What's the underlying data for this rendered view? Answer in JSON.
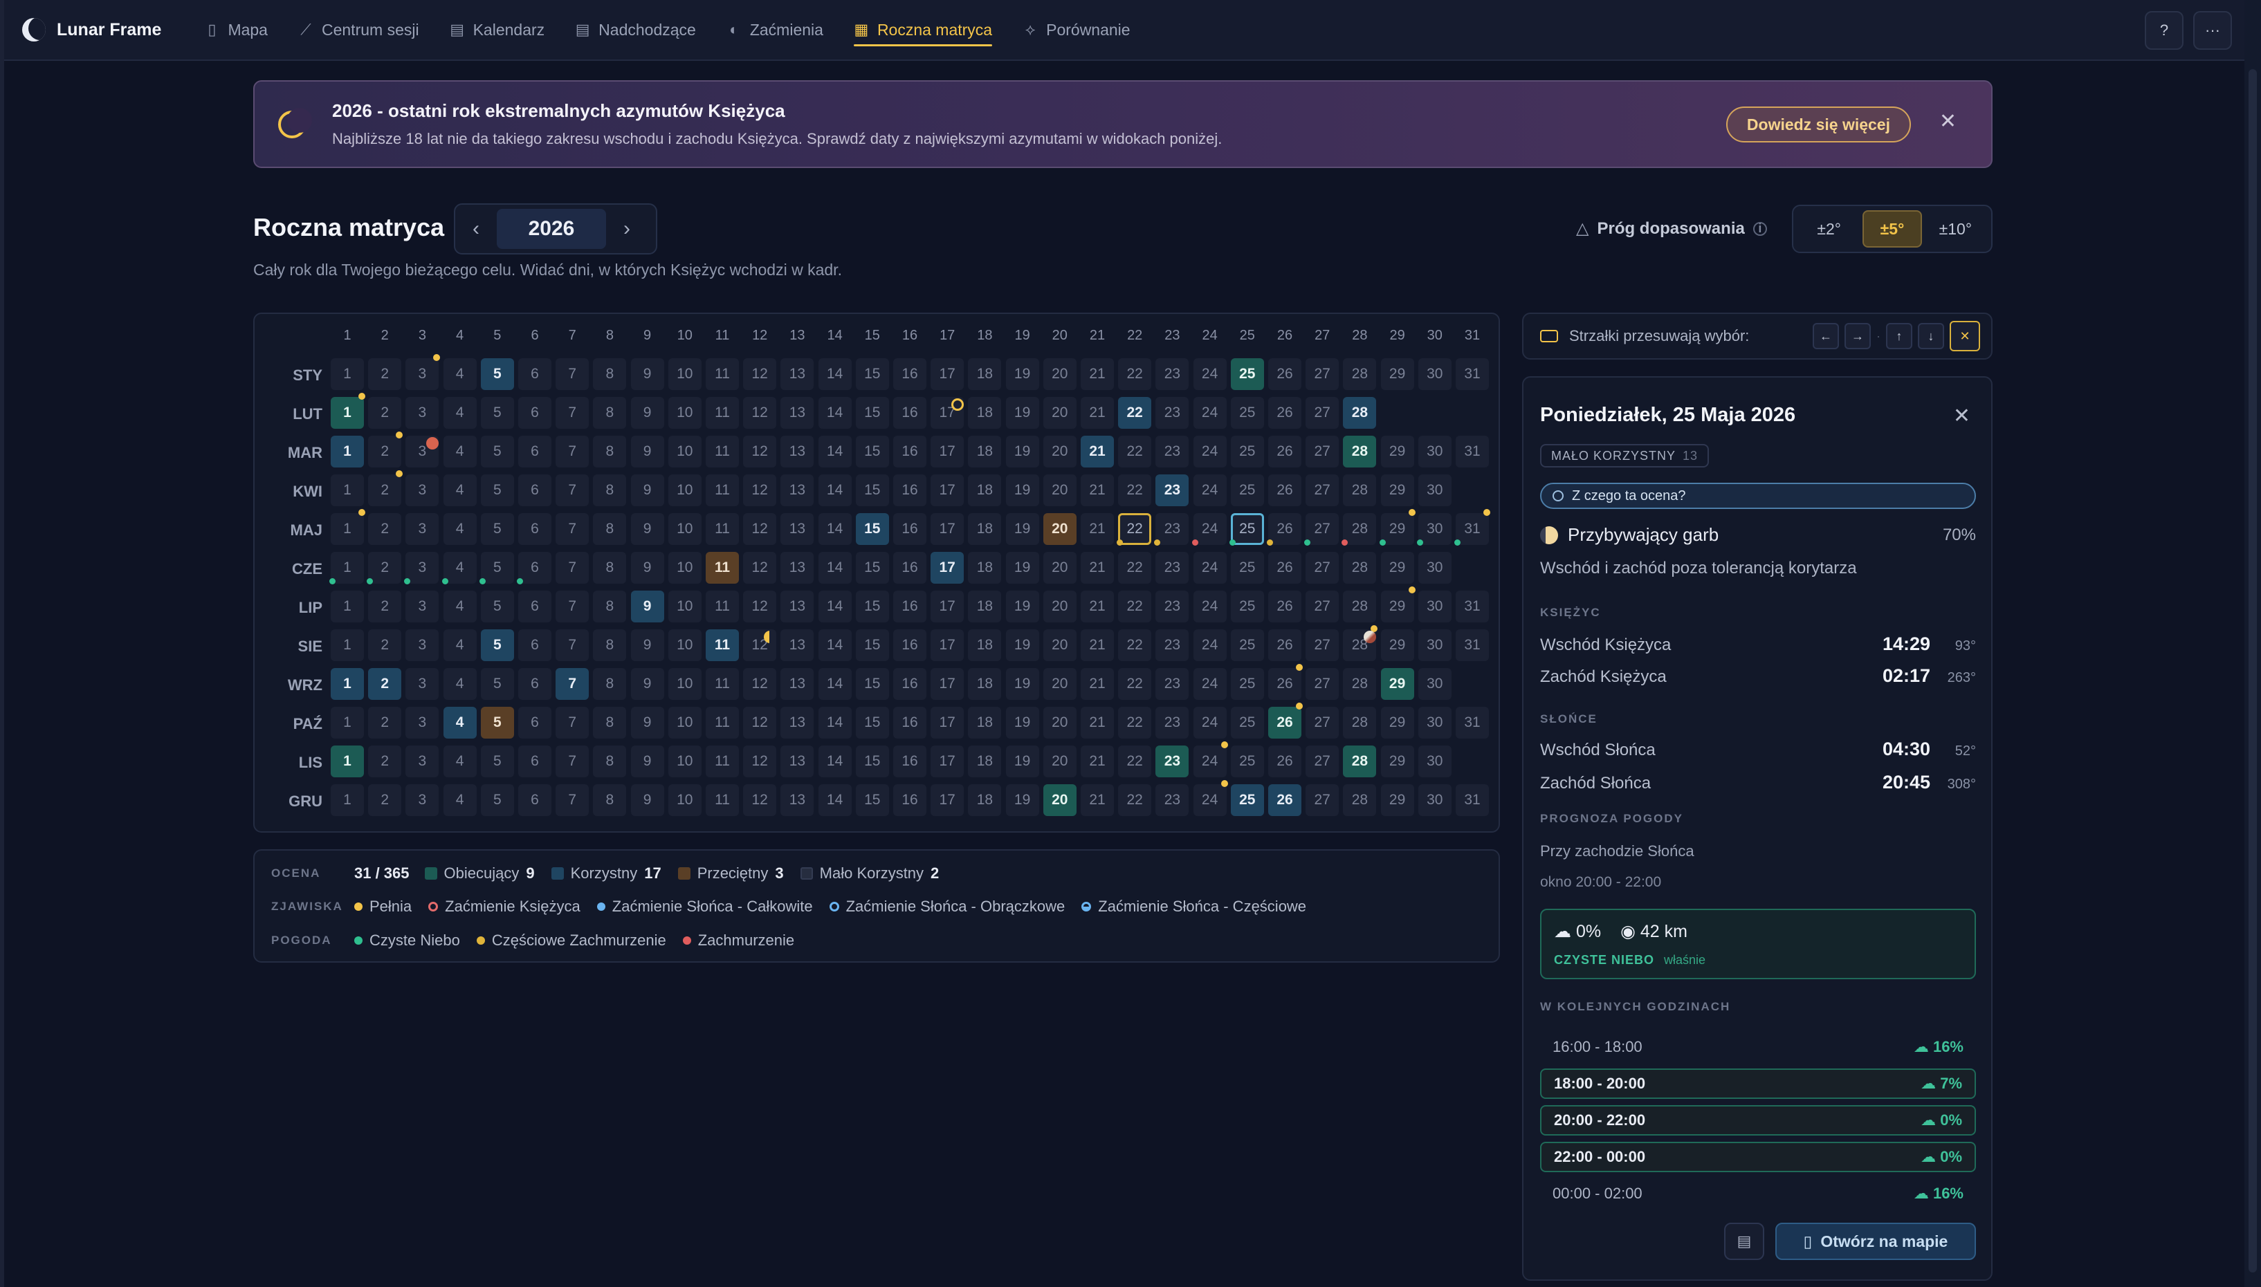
{
  "app": {
    "name": "Lunar Frame",
    "nav": [
      {
        "label": "Mapa",
        "icon": "map-icon",
        "glyph": "▯"
      },
      {
        "label": "Centrum sesji",
        "icon": "telescope-icon",
        "glyph": "⟋"
      },
      {
        "label": "Kalendarz",
        "icon": "calendar-icon",
        "glyph": "▤"
      },
      {
        "label": "Nadchodzące",
        "icon": "calendar-clock-icon",
        "glyph": "▤"
      },
      {
        "label": "Zaćmienia",
        "icon": "eclipse-icon",
        "glyph": "◐"
      },
      {
        "label": "Roczna matryca",
        "icon": "grid-icon",
        "glyph": "▦",
        "active": true
      },
      {
        "label": "Porównanie",
        "icon": "compare-icon",
        "glyph": "⟡"
      }
    ],
    "help_glyph": "?",
    "more_glyph": "···"
  },
  "banner": {
    "title": "2026 - ostatni rok ekstremalnych azymutów Księżyca",
    "subtitle": "Najbliższe 18 lat nie da takiego zakresu wschodu i zachodu Księżyca. Sprawdź daty z największymi azymutami w widokach poniżej.",
    "button": "Dowiedz się więcej",
    "close": "✕"
  },
  "header": {
    "title": "Roczna matryca",
    "year": "2026",
    "prev": "‹",
    "next": "›",
    "subtitle": "Cały rok dla Twojego bieżącego celu. Widać dni, w których Księżyc wchodzi w kadr.",
    "threshold_label": "Próg dopasowania",
    "threshold_options": [
      "±2°",
      "±5°",
      "±10°"
    ],
    "threshold_active": "±5°"
  },
  "matrix": {
    "days_header": [
      "1",
      "2",
      "3",
      "4",
      "5",
      "6",
      "7",
      "8",
      "9",
      "10",
      "11",
      "12",
      "13",
      "14",
      "15",
      "16",
      "17",
      "18",
      "19",
      "20",
      "21",
      "22",
      "23",
      "24",
      "25",
      "26",
      "27",
      "28",
      "29",
      "30",
      "31"
    ],
    "months": [
      {
        "label": "STY",
        "days": 31,
        "prom": [
          25
        ],
        "kor": [
          5
        ],
        "prz": []
      },
      {
        "label": "LUT",
        "days": 28,
        "prom": [
          1
        ],
        "kor": [
          22,
          28
        ],
        "prz": []
      },
      {
        "label": "MAR",
        "days": 31,
        "prom": [
          28
        ],
        "kor": [
          1,
          21
        ],
        "prz": []
      },
      {
        "label": "KWI",
        "days": 30,
        "prom": [],
        "kor": [
          23
        ],
        "prz": []
      },
      {
        "label": "MAJ",
        "days": 31,
        "prom": [],
        "kor": [
          15
        ],
        "prz": [
          20
        ],
        "sel": [
          25
        ],
        "yel": [
          22
        ]
      },
      {
        "label": "CZE",
        "days": 30,
        "prom": [],
        "kor": [
          17
        ],
        "prz": [
          11
        ]
      },
      {
        "label": "LIP",
        "days": 31,
        "prom": [],
        "kor": [
          9
        ],
        "prz": []
      },
      {
        "label": "SIE",
        "days": 31,
        "prom": [],
        "kor": [
          5,
          11
        ],
        "prz": []
      },
      {
        "label": "WRZ",
        "days": 30,
        "prom": [
          29
        ],
        "kor": [
          1,
          2,
          7
        ],
        "prz": []
      },
      {
        "label": "PAŹ",
        "days": 31,
        "prom": [
          26
        ],
        "kor": [
          4
        ],
        "prz": [
          5
        ]
      },
      {
        "label": "LIS",
        "days": 30,
        "prom": [
          1,
          23,
          28
        ],
        "kor": [],
        "prz": []
      },
      {
        "label": "GRU",
        "days": 31,
        "prom": [
          20
        ],
        "kor": [
          25,
          26
        ],
        "prz": []
      }
    ],
    "full_moon_dots": [
      [
        0,
        3
      ],
      [
        1,
        1
      ],
      [
        2,
        2
      ],
      [
        3,
        2
      ],
      [
        4,
        1
      ],
      [
        4,
        31
      ],
      [
        6,
        29
      ],
      [
        7,
        28
      ],
      [
        8,
        26
      ],
      [
        9,
        26
      ],
      [
        10,
        24
      ],
      [
        11,
        24
      ],
      [
        4,
        29
      ]
    ],
    "eclipse_markers": [
      [
        1,
        17,
        "ring"
      ],
      [
        2,
        3,
        "lunar"
      ],
      [
        7,
        12,
        "crescent"
      ],
      [
        7,
        28,
        "moon"
      ]
    ],
    "weather_dots": [
      [
        4,
        22,
        "yellow"
      ],
      [
        4,
        23,
        "yellow"
      ],
      [
        4,
        24,
        "red"
      ],
      [
        4,
        25,
        "green"
      ],
      [
        4,
        26,
        "yellow"
      ],
      [
        4,
        27,
        "green"
      ],
      [
        4,
        28,
        "red"
      ],
      [
        4,
        29,
        "green"
      ],
      [
        4,
        30,
        "green"
      ],
      [
        4,
        31,
        "green"
      ],
      [
        5,
        1,
        "green"
      ],
      [
        5,
        2,
        "green"
      ],
      [
        5,
        3,
        "green"
      ],
      [
        5,
        4,
        "green"
      ],
      [
        5,
        5,
        "green"
      ],
      [
        5,
        6,
        "green"
      ]
    ]
  },
  "legend": {
    "rating_key": "OCENA",
    "rating_total": "31 / 365",
    "ratings": [
      {
        "label": "Obiecujący",
        "count": "9",
        "color": "#1c5b54"
      },
      {
        "label": "Korzystny",
        "count": "17",
        "color": "#1f4561"
      },
      {
        "label": "Przeciętny",
        "count": "3",
        "color": "#5a3f26"
      },
      {
        "label": "Mało Korzystny",
        "count": "2",
        "color": "#262d3f"
      }
    ],
    "phenomena_key": "ZJAWISKA",
    "phenomena": [
      {
        "label": "Pełnia",
        "color": "#f3c449",
        "kind": "dot"
      },
      {
        "label": "Zaćmienie Księżyca",
        "color": "#e26b6b",
        "kind": "ring"
      },
      {
        "label": "Zaćmienie Słońca - Całkowite",
        "color": "#6ab4f0",
        "kind": "dot"
      },
      {
        "label": "Zaćmienie Słońca - Obrączkowe",
        "color": "#6ab4f0",
        "kind": "ring"
      },
      {
        "label": "Zaćmienie Słońca - Częściowe",
        "color": "#6ab4f0",
        "kind": "half"
      }
    ],
    "weather_key": "POGODA",
    "weather": [
      {
        "label": "Czyste Niebo",
        "color": "#2fbf8f"
      },
      {
        "label": "Częściowe Zachmurzenie",
        "color": "#e0b43a"
      },
      {
        "label": "Zachmurzenie",
        "color": "#e05d5d"
      }
    ]
  },
  "arrows_bar": {
    "text": "Strzałki przesuwają wybór:",
    "keys": [
      "←",
      "→",
      "↑",
      "↓"
    ],
    "sep": "·",
    "close": "✕"
  },
  "detail": {
    "title": "Poniedziałek, 25 Maja 2026",
    "close": "✕",
    "badge": "MAŁO KORZYSTNY",
    "badge_score": "13",
    "why": "Z czego ta ocena?",
    "phase": "Przybywający garb",
    "phase_pct": "70%",
    "phase_sub": "Wschód i zachód poza tolerancją korytarza",
    "moon_section": "KSIĘŻYC",
    "moonrise_label": "Wschód Księżyca",
    "moonrise_time": "14:29",
    "moonrise_az": "93°",
    "moonset_label": "Zachód Księżyca",
    "moonset_time": "02:17",
    "moonset_az": "263°",
    "sun_section": "SŁOŃCE",
    "sunrise_label": "Wschód Słońca",
    "sunrise_time": "04:30",
    "sunrise_az": "52°",
    "sunset_label": "Zachód Słońca",
    "sunset_time": "20:45",
    "sunset_az": "308°",
    "weather_section": "PROGNOZA POGODY",
    "weather_ctx": "Przy zachodzie Słońca",
    "weather_window": "okno 20:00 - 22:00",
    "cloud": "0%",
    "visibility": "42 km",
    "sky": "CZYSTE NIEBO",
    "sky_time": "właśnie",
    "hours_section": "W KOLEJNYCH GODZINACH",
    "hours": [
      {
        "range": "16:00 - 18:00",
        "cloud": "16%",
        "hl": false
      },
      {
        "range": "18:00 - 20:00",
        "cloud": "7%",
        "hl": true
      },
      {
        "range": "20:00 - 22:00",
        "cloud": "0%",
        "hl": true
      },
      {
        "range": "22:00 - 00:00",
        "cloud": "0%",
        "hl": true
      },
      {
        "range": "00:00 - 02:00",
        "cloud": "16%",
        "hl": false
      }
    ],
    "open_map": "Otwórz na mapie"
  }
}
